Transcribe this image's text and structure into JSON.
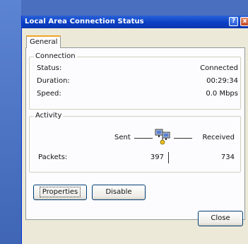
{
  "window": {
    "title": "Local Area Connection Status",
    "help_glyph": "?",
    "close_glyph": "x"
  },
  "tabs": {
    "general": "General"
  },
  "connection": {
    "group_title": "Connection",
    "rows": [
      {
        "label": "Status:",
        "value": "Connected"
      },
      {
        "label": "Duration:",
        "value": "00:29:34"
      },
      {
        "label": "Speed:",
        "value": "0.0 Mbps"
      }
    ]
  },
  "activity": {
    "group_title": "Activity",
    "sent_label": "Sent",
    "received_label": "Received",
    "packets_label": "Packets:",
    "packets_sent": "397",
    "packets_received": "734"
  },
  "buttons": {
    "properties": "Properties",
    "disable": "Disable",
    "close": "Close"
  },
  "icons": {
    "network": "network-activity-icon"
  },
  "colors": {
    "titlebar": "#0a3fc4",
    "dialog": "#ece9d8",
    "desktop": "#4a6fbf"
  }
}
